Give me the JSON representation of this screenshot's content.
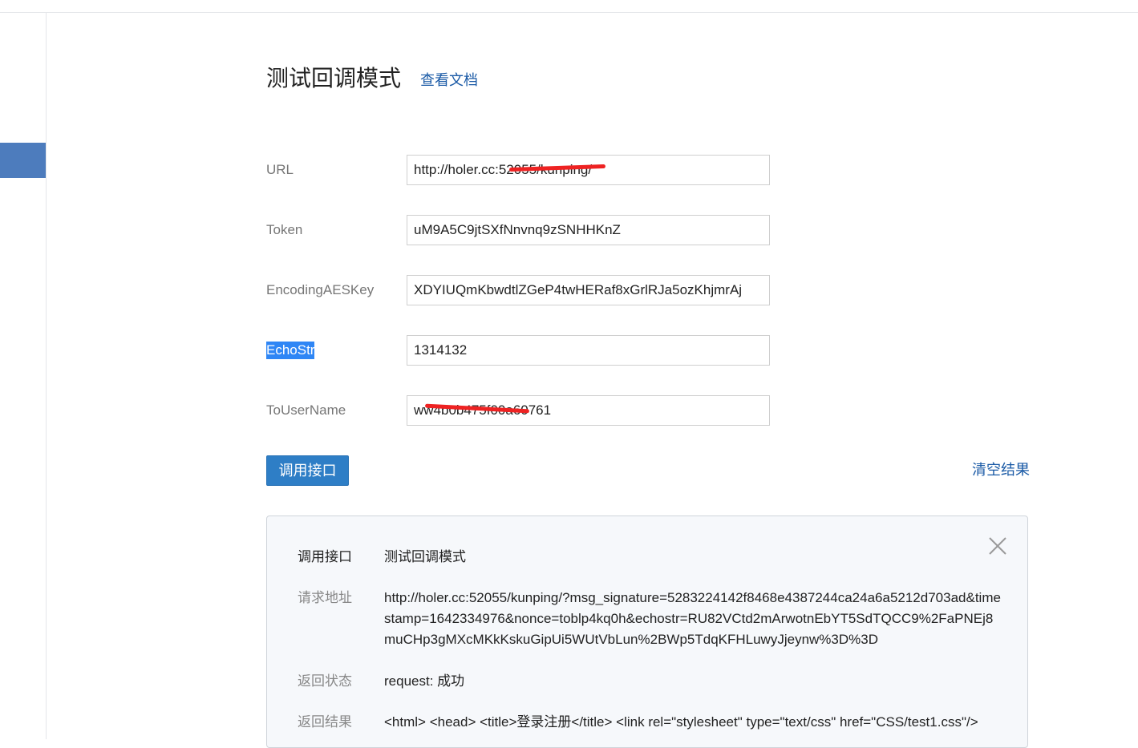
{
  "page": {
    "title": "测试回调模式",
    "doc_link": "查看文档"
  },
  "form": {
    "fields": [
      {
        "label": "URL",
        "value": "http://holer.cc:52055/kunping/"
      },
      {
        "label": "Token",
        "value": "uM9A5C9jtSXfNnvnq9zSNHHKnZ"
      },
      {
        "label": "EncodingAESKey",
        "value": "XDYIUQmKbwdtlZGeP4twHERaf8xGrlRJa5ozKhjmrAj"
      },
      {
        "label": "EchoStr",
        "value": "1314132"
      },
      {
        "label": "ToUserName",
        "value": "ww4b0b475f00a60761"
      }
    ],
    "submit_label": "调用接口",
    "clear_label": "清空结果"
  },
  "result": {
    "rows": [
      {
        "label": "调用接口",
        "value": "测试回调模式"
      },
      {
        "label": "请求地址",
        "value": "http://holer.cc:52055/kunping/?msg_signature=5283224142f8468e4387244ca24a6a5212d703ad&timestamp=1642334976&nonce=toblp4kq0h&echostr=RU82VCtd2mArwotnEbYT5SdTQCC9%2FaPNEj8muCHp3gMXcMKkKskuGipUi5WUtVbLun%2BWp5TdqKFHLuwyJjeynw%3D%3D"
      },
      {
        "label": "返回状态",
        "value": "request: 成功"
      },
      {
        "label": "返回结果",
        "value": "<html> <head> <title>登录注册</title> <link rel=\"stylesheet\" type=\"text/css\" href=\"CSS/test1.css\"/>"
      }
    ]
  },
  "colors": {
    "accent": "#2e7ec6",
    "link": "#1a5aa6",
    "selection": "#2f86f5",
    "sidebar_active": "#4d7cbd"
  },
  "icons": {
    "close": "close-icon"
  }
}
